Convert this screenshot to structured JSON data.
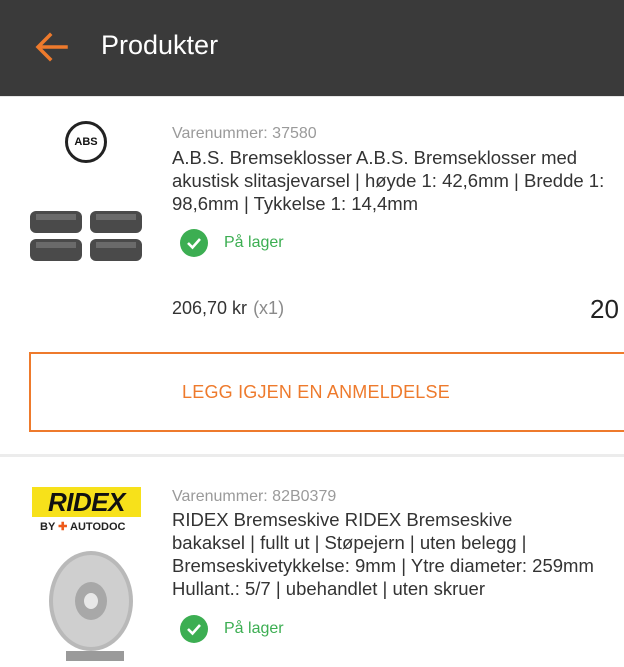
{
  "header": {
    "title": "Produkter",
    "back_icon": "arrow-left-icon",
    "accent": "#ee7a2c"
  },
  "products": [
    {
      "brand_logo_text": "ABS",
      "sku": "Varenummer: 37580",
      "name_lines": [
        "A.B.S. Bremseklosser A.B.S. Bremseklosser med",
        "akustisk slitasjevarsel | høyde 1: 42,6mm | Bredde 1:",
        "98,6mm | Tykkelse 1: 14,4mm"
      ],
      "stock": "På lager",
      "price": "206,70 kr",
      "qty": "(x1)",
      "total": "20",
      "review_button": "LEGG IGJEN EN ANMELDELSE"
    },
    {
      "brand_logo_text": "RIDEX",
      "brand_byline_prefix": "BY",
      "brand_byline_suffix": "AUTODOC",
      "sku": "Varenummer: 82B0379",
      "name_lines": [
        "RIDEX Bremseskive RIDEX Bremseskive",
        "bakaksel | fullt ut | Støpejern | uten belegg |",
        "Bremseskivetykkelse: 9mm | Ytre diameter: 259mm",
        "Hullant.: 5/7 | ubehandlet | uten skruer"
      ],
      "stock": "På lager"
    }
  ],
  "colors": {
    "header_bg": "#3a3a3a",
    "in_stock": "#3cae52",
    "accent": "#ee7a2c"
  }
}
